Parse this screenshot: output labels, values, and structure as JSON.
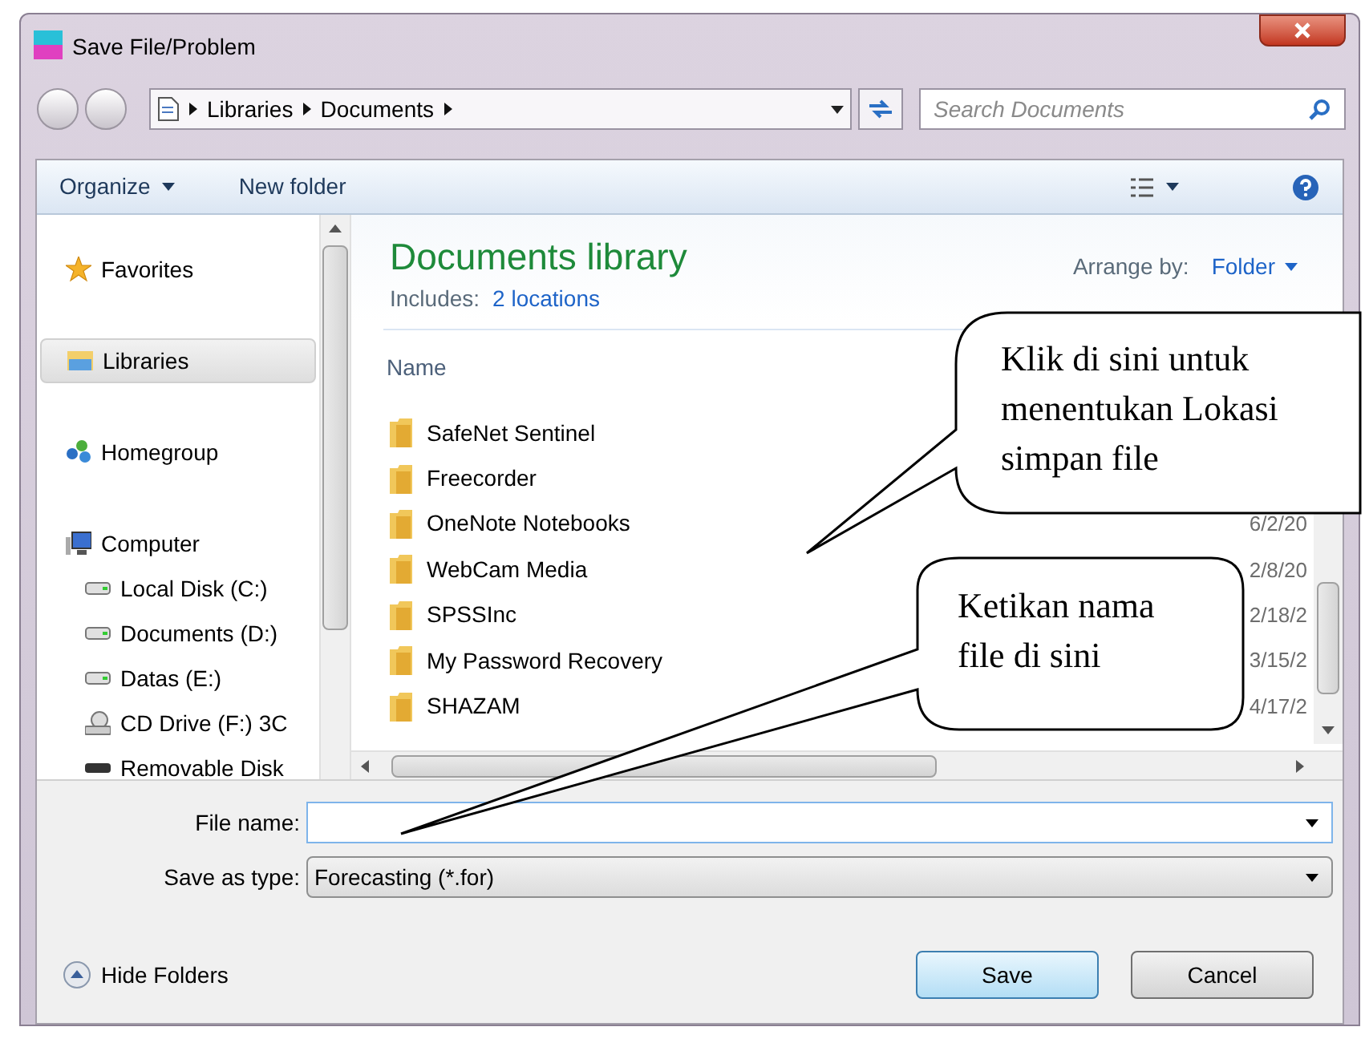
{
  "window": {
    "title": "Save File/Problem"
  },
  "address": {
    "crumbs": [
      "Libraries",
      "Documents"
    ],
    "search_placeholder": "Search Documents"
  },
  "toolbar": {
    "buttons": [
      {
        "label": "Organize",
        "dropdown": true
      },
      {
        "label": "New folder",
        "dropdown": false
      }
    ]
  },
  "navigation": {
    "items": [
      {
        "label": "Favorites",
        "kind": "favorites",
        "selected": false
      },
      {
        "label": "Libraries",
        "kind": "libraries",
        "selected": true
      },
      {
        "label": "Homegroup",
        "kind": "homegroup",
        "selected": false
      },
      {
        "label": "Computer",
        "kind": "computer",
        "selected": false,
        "children": [
          {
            "label": "Local Disk (C:)",
            "kind": "disk",
            "selected": false
          },
          {
            "label": "Documents (D:)",
            "kind": "disk",
            "selected": false
          },
          {
            "label": "Datas (E:)",
            "kind": "disk",
            "selected": false
          },
          {
            "label": "CD Drive (F:) 3C",
            "kind": "cd",
            "selected": false
          },
          {
            "label": "Removable Disk",
            "kind": "removable",
            "selected": false
          }
        ]
      }
    ]
  },
  "library": {
    "title": "Documents library",
    "includes_label": "Includes:",
    "includes_link": "2 locations",
    "arrange_label": "Arrange by:",
    "arrange_value": "Folder",
    "column": "Name",
    "folders": [
      {
        "name": "SafeNet Sentinel"
      },
      {
        "name": "Freecorder"
      },
      {
        "name": "OneNote Notebooks",
        "date": "6/2/20"
      },
      {
        "name": "WebCam Media",
        "date": "2/8/20"
      },
      {
        "name": "SPSSInc",
        "date": "2/18/2"
      },
      {
        "name": "My Password Recovery",
        "date": "3/15/2"
      },
      {
        "name": "SHAZAM",
        "date": "4/17/2"
      }
    ]
  },
  "file_name": {
    "label": "File name:"
  },
  "save_as_type": {
    "label": "Save as type:",
    "value": "Forecasting (*.for)"
  },
  "hide_folders": "Hide Folders",
  "buttons": [
    {
      "label": "Save",
      "default": true
    },
    {
      "label": "Cancel",
      "default": false
    }
  ],
  "callouts": [
    {
      "text": "Klik di sini untuk menentukan Lokasi simpan file"
    },
    {
      "text": "Ketikan nama file di sini"
    }
  ]
}
